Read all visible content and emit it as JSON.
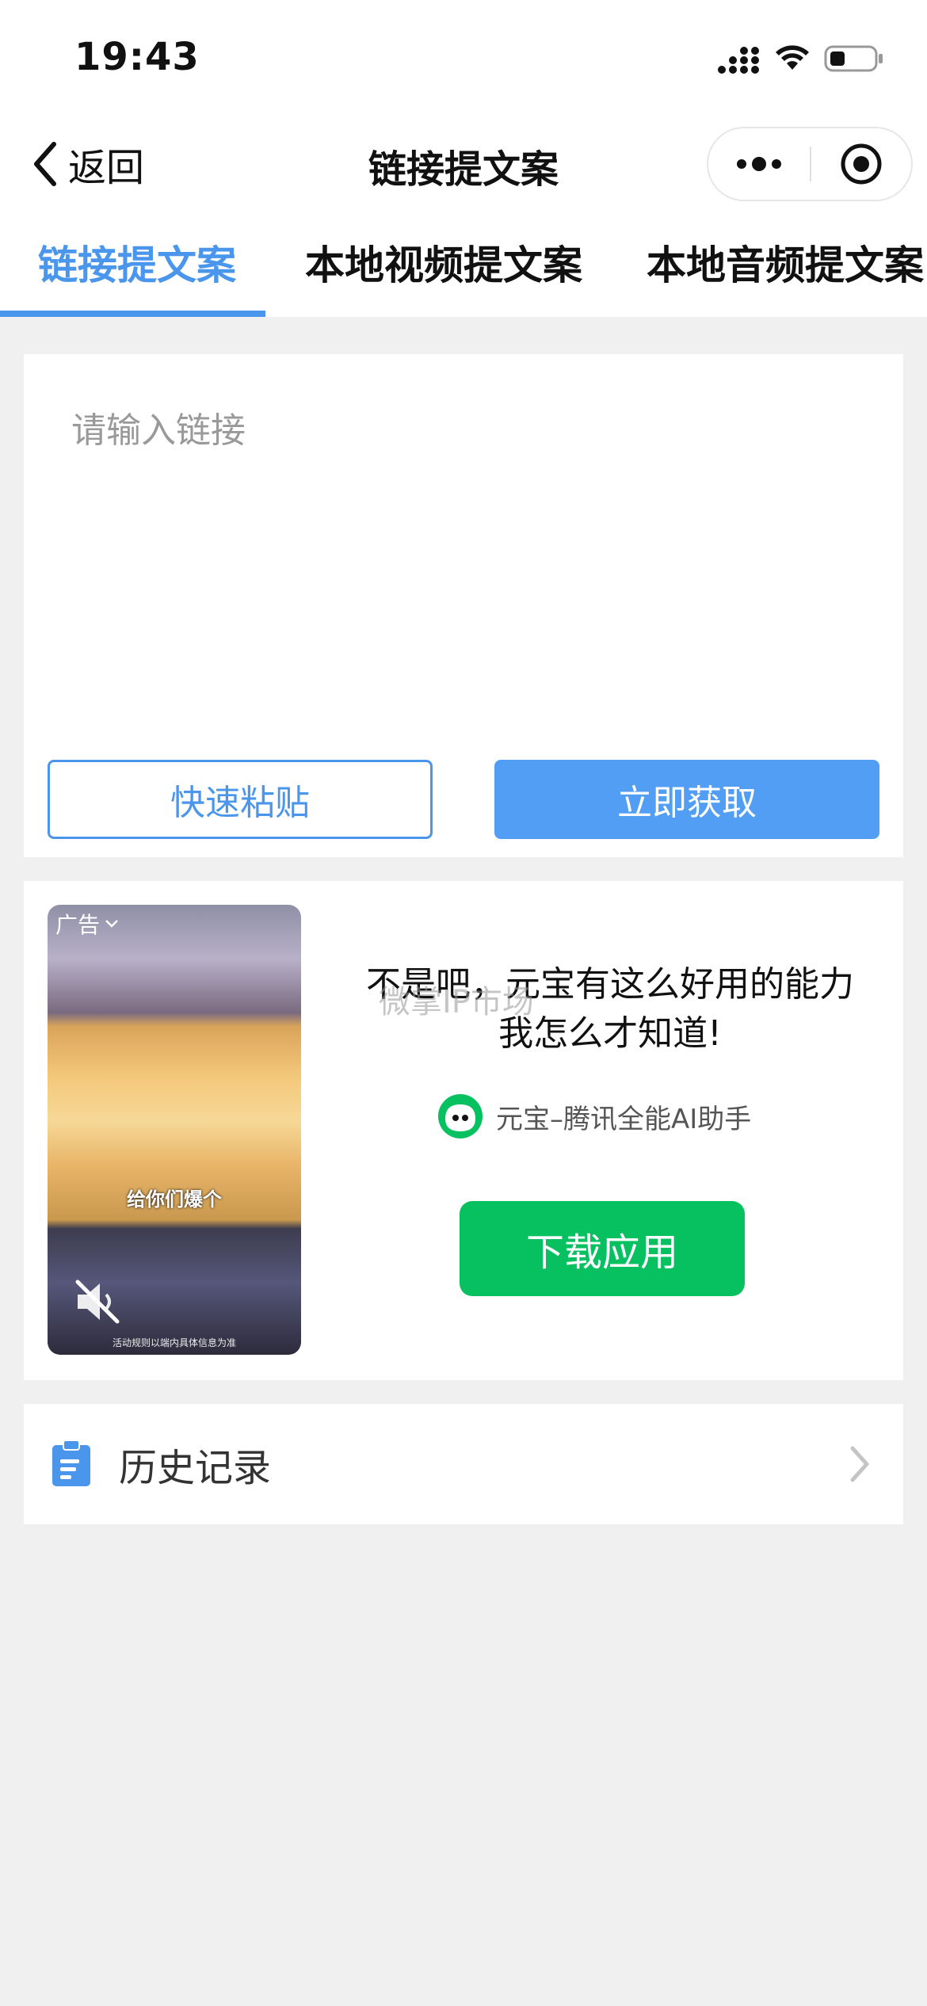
{
  "status_bar": {
    "time": "19:43"
  },
  "nav": {
    "back_label": "返回",
    "title": "链接提文案"
  },
  "tabs": [
    {
      "label": "链接提文案",
      "active": true
    },
    {
      "label": "本地视频提文案",
      "active": false
    },
    {
      "label": "本地音频提文案",
      "active": false
    }
  ],
  "input_card": {
    "placeholder": "请输入链接",
    "value": "",
    "paste_button": "快速粘贴",
    "fetch_button": "立即获取"
  },
  "ad": {
    "badge": "广告",
    "video_caption": "给你们爆个",
    "video_fine_print": "活动规则以端内具体信息为准",
    "headline": "不是吧，元宝有这么好用的能力我怎么才知道!",
    "watermark": "微掌IP市场",
    "brand_name": "元宝–腾讯全能AI助手",
    "download_button": "下载应用"
  },
  "history": {
    "label": "历史记录"
  },
  "colors": {
    "accent": "#4a96ed",
    "primary_button": "#529ef5",
    "download_green": "#07c160",
    "background": "#f0f0f0"
  }
}
